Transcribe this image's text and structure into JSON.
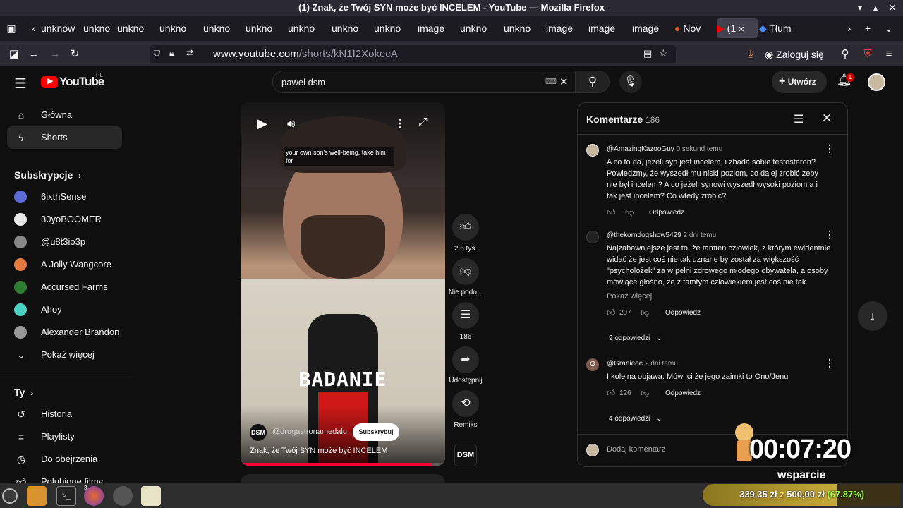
{
  "window": {
    "title": "(1) Znak, że Twój SYN może być INCELEM - YouTube — Mozilla Firefox"
  },
  "tabs": [
    {
      "label": "unknow"
    },
    {
      "label": "unkno"
    },
    {
      "label": "unkno"
    },
    {
      "label": "unkno"
    },
    {
      "label": "unkno"
    },
    {
      "label": "unkno"
    },
    {
      "label": "unkno"
    },
    {
      "label": "unkno"
    },
    {
      "label": "unkno"
    },
    {
      "label": "image"
    },
    {
      "label": "unkno"
    },
    {
      "label": "unkno"
    },
    {
      "label": "image"
    },
    {
      "label": "image"
    },
    {
      "label": "image"
    },
    {
      "label": "Nov"
    },
    {
      "label": "(1"
    },
    {
      "label": "Tłum"
    }
  ],
  "url": {
    "domain": "www.youtube.com",
    "path": "/shorts/kN1I2XokecA"
  },
  "account": {
    "login": "Zaloguj się"
  },
  "youtube": {
    "logo": "YouTube",
    "region": "PL",
    "search_value": "paweł dsm",
    "create": "Utwórz",
    "notif_count": "1"
  },
  "sidebar": {
    "main": [
      {
        "label": "Główna",
        "icon": "home-icon"
      },
      {
        "label": "Shorts",
        "icon": "shorts-icon"
      }
    ],
    "subs_title": "Subskrypcje",
    "subs": [
      {
        "label": "6ixthSense",
        "color": "#5b6bd6"
      },
      {
        "label": "30yoBOOMER",
        "color": "#e8e8e8"
      },
      {
        "label": "@u8t3io3p",
        "color": "#888"
      },
      {
        "label": "A Jolly Wangcore",
        "color": "#e27a3f"
      },
      {
        "label": "Accursed Farms",
        "color": "#2f7d32"
      },
      {
        "label": "Ahoy",
        "color": "#4dd0c4"
      },
      {
        "label": "Alexander Brandon ...",
        "color": "#999"
      }
    ],
    "more": "Pokaż więcej",
    "you_title": "Ty",
    "you": [
      {
        "label": "Historia",
        "icon": "history-icon"
      },
      {
        "label": "Playlisty",
        "icon": "playlist-icon"
      },
      {
        "label": "Do obejrzenia",
        "icon": "watch-later-icon"
      },
      {
        "label": "Polubione filmy",
        "icon": "like-icon"
      }
    ]
  },
  "video": {
    "caption": "your own son's well-being, take him for",
    "overlay": "BADANIE",
    "channel": "@drugastronamedalu",
    "subscribe": "Subskrybuj",
    "title": "Znak, że Twój SYN może być INCELEM",
    "logo": "DSM"
  },
  "actions": {
    "likes": "2,6 tys.",
    "dislike": "Nie podo...",
    "comments": "186",
    "share": "Udostępnij",
    "remix": "Remiks"
  },
  "comments": {
    "title": "Komentarze",
    "count": "186",
    "items": [
      {
        "author": "@AmazingKazooGuy",
        "time": "0 sekund temu",
        "text": "A co to da, jeżeli syn jest incelem, i zbada sobie testosteron? Powiedzmy, że wyszedł mu niski poziom, co dalej zrobić żeby nie był incelem? A co jeżeli synowi wyszedł wysoki poziom a i tak jest incelem? Co wtedy zrobić?",
        "likes": "",
        "reply": "Odpowiedz"
      },
      {
        "author": "@thekorndogshow5429",
        "time": "2 dni temu",
        "text": "Najzabawniejsze jest to, że tamten człowiek, z którym ewidentnie widać że jest coś nie tak uznane by został za większość \"psycholożek\" za w pełni zdrowego młodego obywatela, a osoby mówiące głośno, że z tamtym człowiekiem jest coś nie tak byłyby...",
        "more": "Pokaż więcej",
        "likes": "207",
        "reply": "Odpowiedz",
        "replies": "9 odpowiedzi"
      },
      {
        "author": "@Granieee",
        "time": "2 dni temu",
        "text": "I kolejna objawa: Mówi ci że jego zaimki to Ono/Jenu",
        "likes": "126",
        "reply": "Odpowiedz",
        "replies": "4 odpowiedzi",
        "avatar_letter": "G"
      }
    ],
    "add_placeholder": "Dodaj komentarz"
  },
  "overlay": {
    "timer": "00:07:20",
    "label": "wsparcie",
    "donation": "339,35 zł",
    "donation_of": "z",
    "donation_goal": "500,00 zł",
    "donation_pct": "(67.87%)",
    "pct_value": 67.87
  },
  "taskbar": {
    "firefox_badge": "3"
  }
}
